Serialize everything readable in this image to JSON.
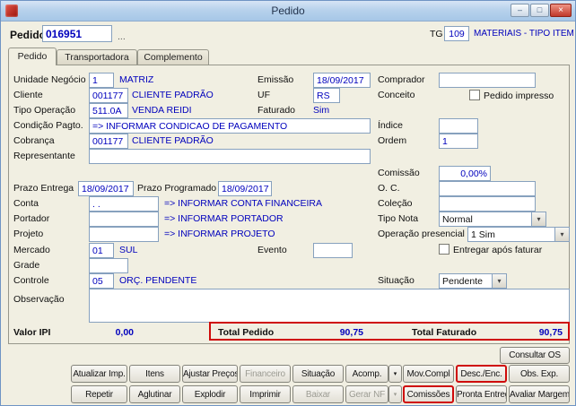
{
  "window": {
    "title": "Pedido"
  },
  "icons": {
    "dropdown_arrow": "▾",
    "minimize": "–",
    "maximize": "□",
    "close": "×"
  },
  "colors": {
    "value_text": "#0000bd",
    "highlight": "#cf0a0a"
  },
  "header": {
    "pedido_label": "Pedido",
    "pedido_value": "016951",
    "more": "...",
    "tg_label": "TG",
    "tg_value": "109",
    "tg_desc": "MATERIAIS - TIPO ITEM"
  },
  "tabs": [
    {
      "label": "Pedido"
    },
    {
      "label": "Transportadora"
    },
    {
      "label": "Complemento"
    }
  ],
  "form": {
    "unidade_negocio": {
      "label": "Unidade Negócio",
      "code": "1",
      "desc": "MATRIZ"
    },
    "emissao": {
      "label": "Emissão",
      "value": "18/09/2017"
    },
    "comprador": {
      "label": "Comprador",
      "value": ""
    },
    "cliente": {
      "label": "Cliente",
      "code": "001177",
      "desc": "CLIENTE PADRÃO"
    },
    "uf": {
      "label": "UF",
      "value": "RS"
    },
    "conceito": {
      "label": "Conceito"
    },
    "pedido_impresso": {
      "label": "Pedido impresso",
      "checked": false
    },
    "tipo_operacao": {
      "label": "Tipo Operação",
      "code": "511.0A",
      "desc": "VENDA REIDI"
    },
    "faturado": {
      "label": "Faturado",
      "value": "Sim"
    },
    "condicao_pagto": {
      "label": "Condição Pagto.",
      "value": "=> INFORMAR CONDICAO DE PAGAMENTO"
    },
    "indice": {
      "label": "Índice",
      "value": ""
    },
    "cobranca": {
      "label": "Cobrança",
      "code": "001177",
      "desc": "CLIENTE PADRÃO"
    },
    "ordem": {
      "label": "Ordem",
      "value": "1"
    },
    "representante": {
      "label": "Representante",
      "value": ""
    },
    "comissao": {
      "label": "Comissão",
      "value": "0,00%"
    },
    "prazo_entrega": {
      "label": "Prazo Entrega",
      "value": "18/09/2017"
    },
    "prazo_programado": {
      "label": "Prazo Programado",
      "value": "18/09/2017"
    },
    "oc": {
      "label": "O. C.",
      "value": ""
    },
    "conta": {
      "label": "Conta",
      "code": ". .",
      "desc": "=> INFORMAR CONTA FINANCEIRA"
    },
    "colecao": {
      "label": "Coleção",
      "value": ""
    },
    "portador": {
      "label": "Portador",
      "code": "",
      "desc": "=> INFORMAR PORTADOR"
    },
    "tipo_nota": {
      "label": "Tipo Nota",
      "value": "Normal"
    },
    "projeto": {
      "label": "Projeto",
      "code": "",
      "desc": "=> INFORMAR PROJETO"
    },
    "operacao_presencial": {
      "label": "Operação presencial",
      "value": "1 Sim"
    },
    "mercado": {
      "label": "Mercado",
      "code": "01",
      "desc": "SUL"
    },
    "evento": {
      "label": "Evento",
      "value": ""
    },
    "entregar_apos_faturar": {
      "label": "Entregar após faturar",
      "checked": false
    },
    "grade": {
      "label": "Grade",
      "value": ""
    },
    "controle": {
      "label": "Controle",
      "code": "05",
      "desc": "ORÇ. PENDENTE"
    },
    "situacao": {
      "label": "Situação",
      "value": "Pendente"
    },
    "observacao": {
      "label": "Observação",
      "value": ""
    }
  },
  "totals": {
    "valor_ipi_label": "Valor IPI",
    "valor_ipi_value": "0,00",
    "total_pedido_label": "Total Pedido",
    "total_pedido_value": "90,75",
    "total_faturado_label": "Total Faturado",
    "total_faturado_value": "90,75"
  },
  "actions": {
    "consultar_os": "Consultar OS",
    "row1": [
      "Atualizar Imp.",
      "Itens",
      "Ajustar Preços",
      "Financeiro",
      "Situação",
      "Acomp.",
      "Mov.Compl",
      "Desc./Enc.",
      "Obs. Exp."
    ],
    "row2": [
      "Repetir",
      "Aglutinar",
      "Explodir",
      "Imprimir",
      "Baixar",
      "Gerar NF",
      "Comissões",
      "Pronta Entrega",
      "Avaliar Margem"
    ]
  }
}
